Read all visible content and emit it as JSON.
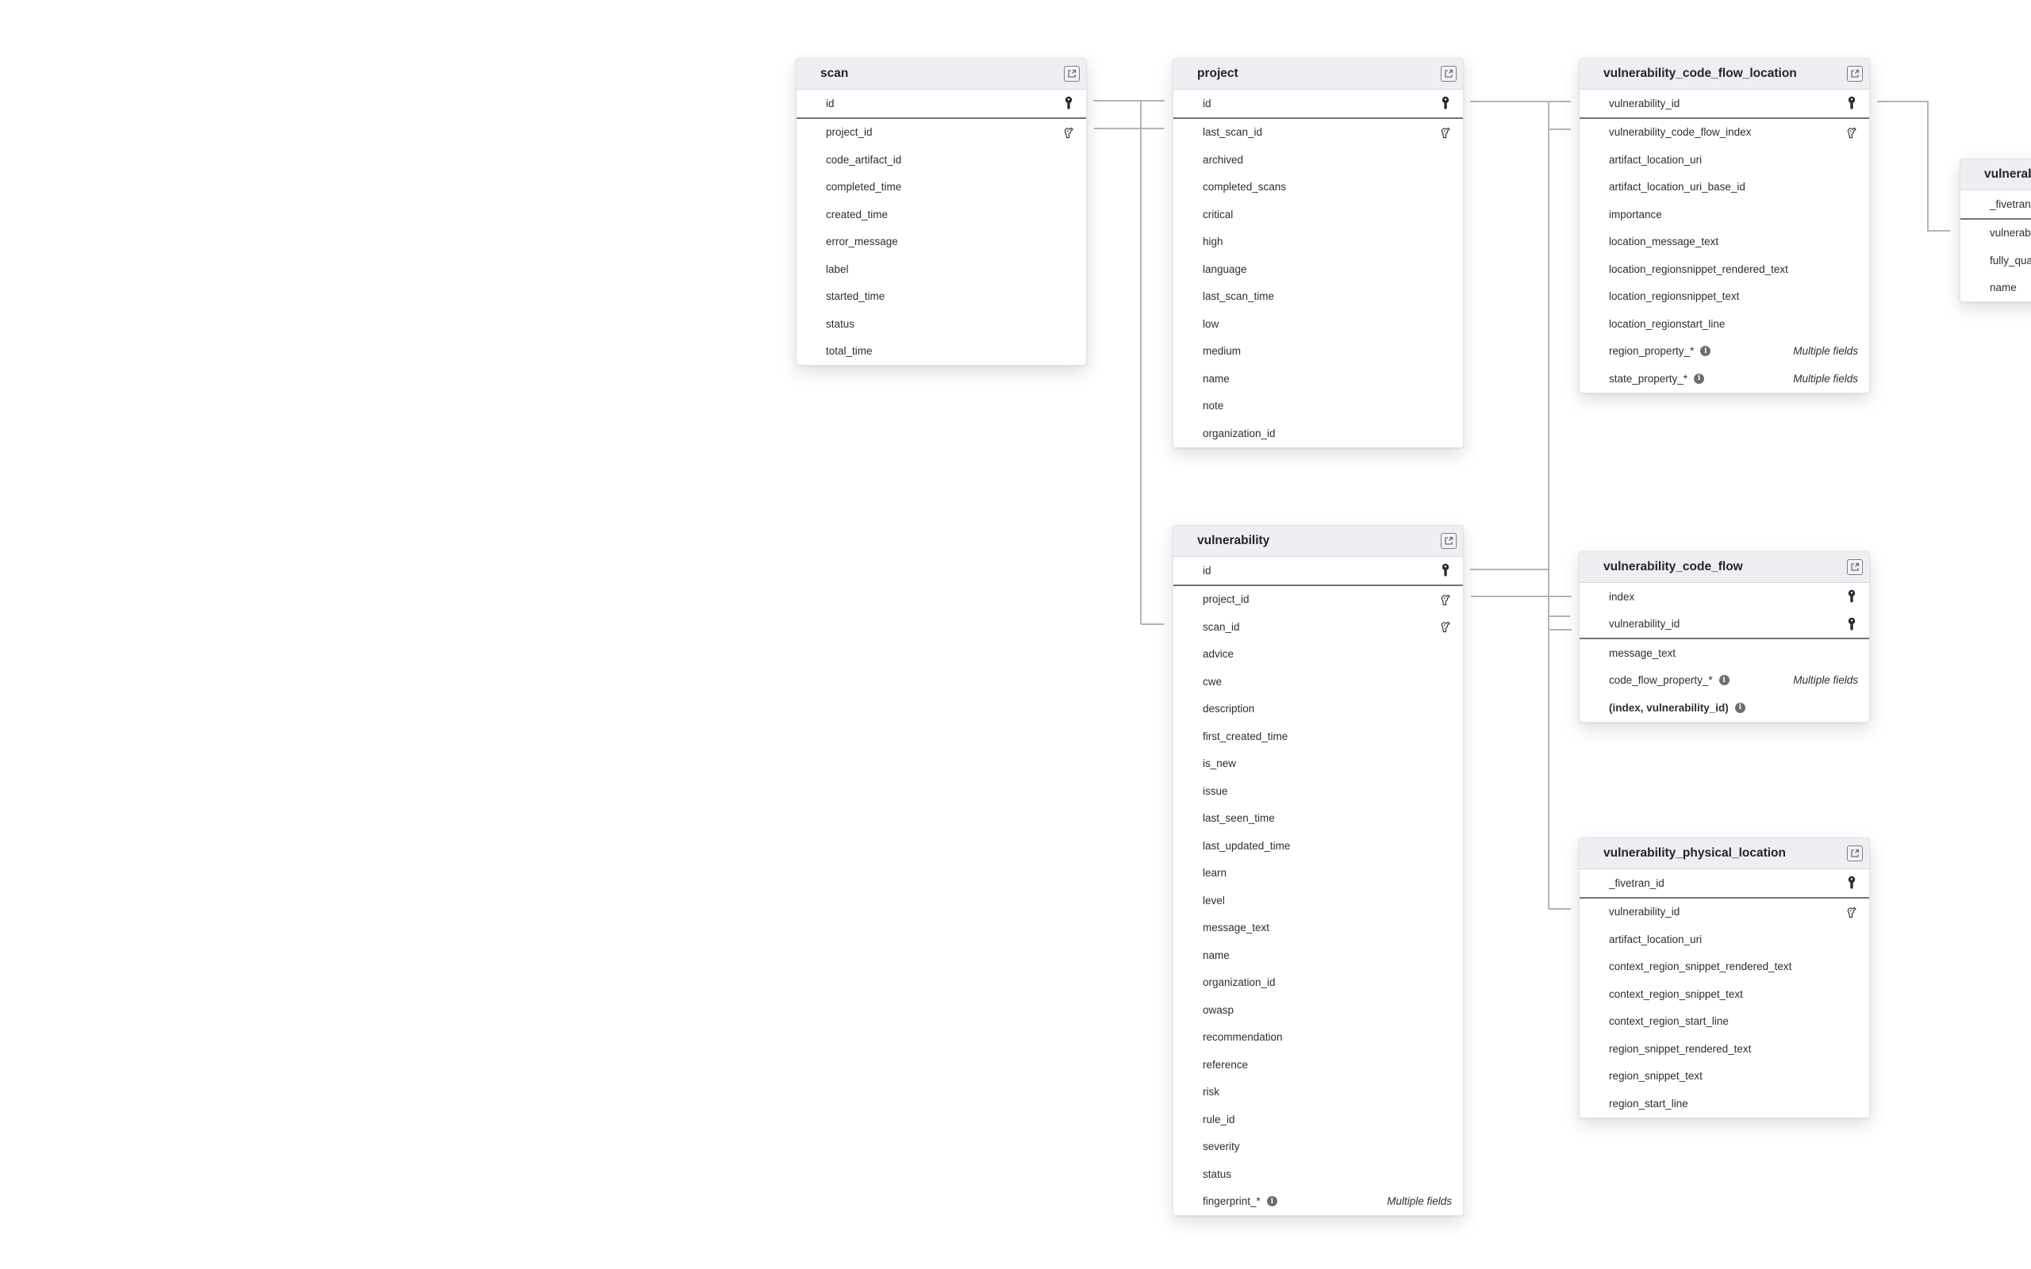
{
  "diagram": {
    "tables": [
      {
        "id": "scan",
        "title": "scan",
        "columns": [
          {
            "name": "id",
            "key": "primary"
          },
          {
            "name": "project_id",
            "key": "foreign"
          },
          {
            "name": "code_artifact_id"
          },
          {
            "name": "completed_time"
          },
          {
            "name": "created_time"
          },
          {
            "name": "error_message"
          },
          {
            "name": "label"
          },
          {
            "name": "started_time"
          },
          {
            "name": "status"
          },
          {
            "name": "total_time"
          }
        ]
      },
      {
        "id": "project",
        "title": "project",
        "columns": [
          {
            "name": "id",
            "key": "primary"
          },
          {
            "name": "last_scan_id",
            "key": "foreign"
          },
          {
            "name": "archived"
          },
          {
            "name": "completed_scans"
          },
          {
            "name": "critical"
          },
          {
            "name": "high"
          },
          {
            "name": "language"
          },
          {
            "name": "last_scan_time"
          },
          {
            "name": "low"
          },
          {
            "name": "medium"
          },
          {
            "name": "name"
          },
          {
            "name": "note"
          },
          {
            "name": "organization_id"
          }
        ]
      },
      {
        "id": "vulnerability_code_flow_location",
        "title": "vulnerability_code_flow_location",
        "columns": [
          {
            "name": "vulnerability_id",
            "key": "primary"
          },
          {
            "name": "vulnerability_code_flow_index",
            "key": "foreign"
          },
          {
            "name": "artifact_location_uri"
          },
          {
            "name": "artifact_location_uri_base_id"
          },
          {
            "name": "importance"
          },
          {
            "name": "location_message_text"
          },
          {
            "name": "location_regionsnippet_rendered_text"
          },
          {
            "name": "location_regionsnippet_text"
          },
          {
            "name": "location_regionstart_line"
          },
          {
            "name": "region_property_*",
            "info": true,
            "note": "Multiple fields"
          },
          {
            "name": "state_property_*",
            "info": true,
            "note": "Multiple fields"
          }
        ]
      },
      {
        "id": "vulnerability_partial",
        "title": "vulnerab",
        "columns": [
          {
            "name": "_fivetran",
            "key": "primary"
          },
          {
            "name": "vulnerab"
          },
          {
            "name": "fully_qua"
          },
          {
            "name": "name"
          }
        ]
      },
      {
        "id": "vulnerability",
        "title": "vulnerability",
        "columns": [
          {
            "name": "id",
            "key": "primary"
          },
          {
            "name": "project_id",
            "key": "foreign"
          },
          {
            "name": "scan_id",
            "key": "foreign"
          },
          {
            "name": "advice"
          },
          {
            "name": "cwe"
          },
          {
            "name": "description"
          },
          {
            "name": "first_created_time"
          },
          {
            "name": "is_new"
          },
          {
            "name": "issue"
          },
          {
            "name": "last_seen_time"
          },
          {
            "name": "last_updated_time"
          },
          {
            "name": "learn"
          },
          {
            "name": "level"
          },
          {
            "name": "message_text"
          },
          {
            "name": "name"
          },
          {
            "name": "organization_id"
          },
          {
            "name": "owasp"
          },
          {
            "name": "recommendation"
          },
          {
            "name": "reference"
          },
          {
            "name": "risk"
          },
          {
            "name": "rule_id"
          },
          {
            "name": "severity"
          },
          {
            "name": "status"
          },
          {
            "name": "fingerprint_*",
            "info": true,
            "note": "Multiple fields"
          }
        ]
      },
      {
        "id": "vulnerability_code_flow",
        "title": "vulnerability_code_flow",
        "columns": [
          {
            "name": "index",
            "key": "primary"
          },
          {
            "name": "vulnerability_id",
            "key": "primary"
          },
          {
            "name": "message_text"
          },
          {
            "name": "code_flow_property_*",
            "info": true,
            "note": "Multiple fields"
          },
          {
            "name": "(index, vulnerability_id)",
            "info": true,
            "bold": true
          }
        ]
      },
      {
        "id": "vulnerability_physical_location",
        "title": "vulnerability_physical_location",
        "columns": [
          {
            "name": "_fivetran_id",
            "key": "primary"
          },
          {
            "name": "vulnerability_id",
            "key": "foreign"
          },
          {
            "name": "artifact_location_uri"
          },
          {
            "name": "context_region_snippet_rendered_text"
          },
          {
            "name": "context_region_snippet_text"
          },
          {
            "name": "context_region_start_line"
          },
          {
            "name": "region_snippet_rendered_text"
          },
          {
            "name": "region_snippet_text"
          },
          {
            "name": "region_start_line"
          }
        ]
      }
    ],
    "colors": {
      "header_bg": "#eeeff3",
      "connector": "#b2b4ba",
      "text": "#2c2e33"
    }
  }
}
